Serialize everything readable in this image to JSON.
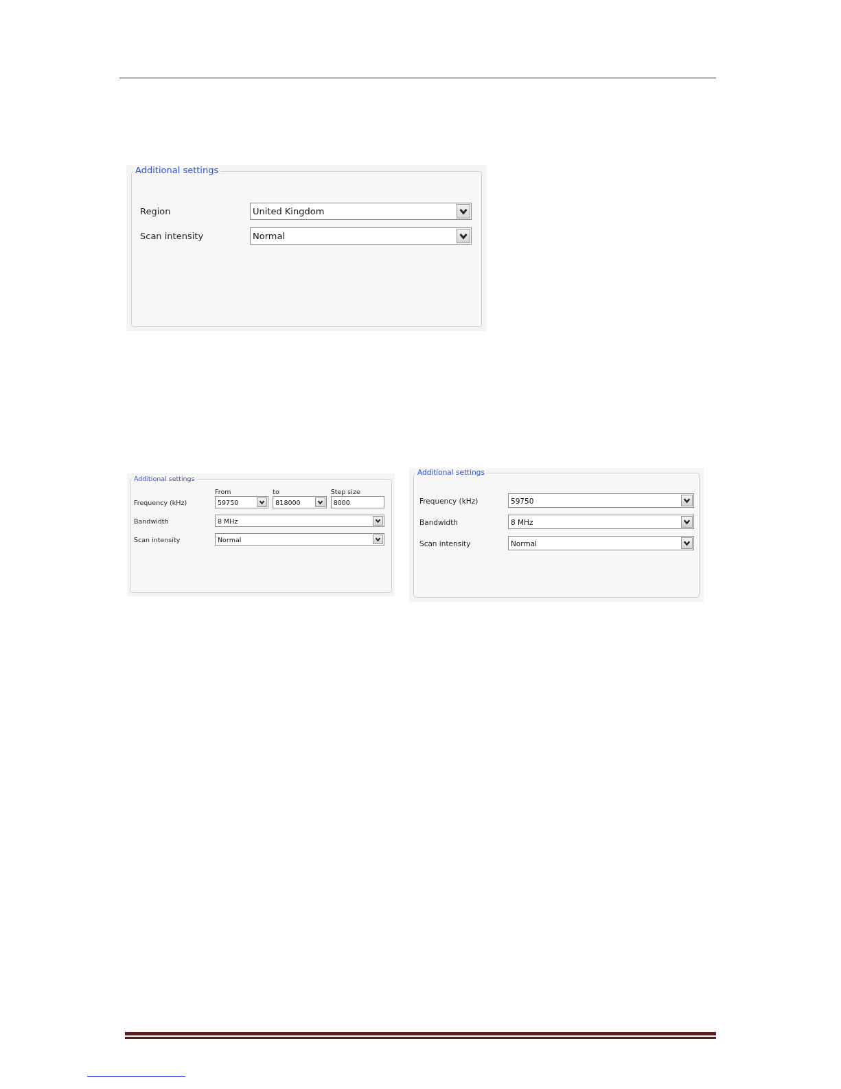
{
  "panels": [
    {
      "legend": "Additional settings",
      "rows": [
        {
          "kind": "dropdown",
          "label": "Region",
          "value": "United Kingdom"
        },
        {
          "kind": "dropdown",
          "label": "Scan intensity",
          "value": "Normal"
        }
      ]
    },
    {
      "legend": "Additional settings",
      "rows": [
        {
          "kind": "range",
          "label": "Frequency (kHz)",
          "fields": [
            {
              "kind": "dropdown",
              "heading": "From",
              "value": "59750"
            },
            {
              "kind": "dropdown",
              "heading": "to",
              "value": "818000"
            },
            {
              "kind": "text",
              "heading": "Step size",
              "value": "8000"
            }
          ]
        },
        {
          "kind": "dropdown",
          "label": "Bandwidth",
          "value": "8 MHz"
        },
        {
          "kind": "dropdown",
          "label": "Scan intensity",
          "value": "Normal"
        }
      ]
    },
    {
      "legend": "Additional settings",
      "rows": [
        {
          "kind": "dropdown",
          "label": "Frequency (kHz)",
          "value": "59750"
        },
        {
          "kind": "dropdown",
          "label": "Bandwidth",
          "value": "8 MHz"
        },
        {
          "kind": "dropdown",
          "label": "Scan intensity",
          "value": "Normal"
        }
      ]
    }
  ]
}
